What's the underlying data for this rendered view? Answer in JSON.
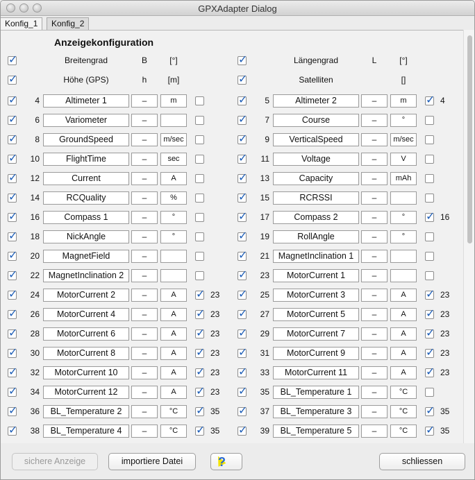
{
  "window": {
    "title": "GPXAdapter Dialog"
  },
  "tabs": [
    {
      "label": "Konfig_1"
    },
    {
      "label": "Konfig_2"
    }
  ],
  "panel": {
    "heading": "Anzeigekonfiguration",
    "fixed_rows": [
      {
        "left": {
          "checked": true,
          "name": "Breitengrad",
          "symbol": "B",
          "unit": "[°]"
        },
        "right": {
          "checked": true,
          "name": "Längengrad",
          "symbol": "L",
          "unit": "[°]"
        }
      },
      {
        "left": {
          "checked": true,
          "name": "Höhe (GPS)",
          "symbol": "h",
          "unit": "[m]"
        },
        "right": {
          "checked": true,
          "name": "Satelliten",
          "symbol": "",
          "unit": "[]"
        }
      }
    ],
    "rows": [
      {
        "left": {
          "checked": true,
          "num": "4",
          "name": "Altimeter 1",
          "symbol": "–",
          "unit": "m",
          "extra_checked": false,
          "extra_value": ""
        },
        "right": {
          "checked": true,
          "num": "5",
          "name": "Altimeter 2",
          "symbol": "–",
          "unit": "m",
          "extra_checked": true,
          "extra_value": "4"
        }
      },
      {
        "left": {
          "checked": true,
          "num": "6",
          "name": "Variometer",
          "symbol": "–",
          "unit": "",
          "extra_checked": false,
          "extra_value": ""
        },
        "right": {
          "checked": true,
          "num": "7",
          "name": "Course",
          "symbol": "–",
          "unit": "°",
          "extra_checked": false,
          "extra_value": ""
        }
      },
      {
        "left": {
          "checked": true,
          "num": "8",
          "name": "GroundSpeed",
          "symbol": "–",
          "unit": "m/sec",
          "extra_checked": false,
          "extra_value": ""
        },
        "right": {
          "checked": true,
          "num": "9",
          "name": "VerticalSpeed",
          "symbol": "–",
          "unit": "m/sec",
          "extra_checked": false,
          "extra_value": ""
        }
      },
      {
        "left": {
          "checked": true,
          "num": "10",
          "name": "FlightTime",
          "symbol": "–",
          "unit": "sec",
          "extra_checked": false,
          "extra_value": ""
        },
        "right": {
          "checked": true,
          "num": "11",
          "name": "Voltage",
          "symbol": "–",
          "unit": "V",
          "extra_checked": false,
          "extra_value": ""
        }
      },
      {
        "left": {
          "checked": true,
          "num": "12",
          "name": "Current",
          "symbol": "–",
          "unit": "A",
          "extra_checked": false,
          "extra_value": ""
        },
        "right": {
          "checked": true,
          "num": "13",
          "name": "Capacity",
          "symbol": "–",
          "unit": "mAh",
          "extra_checked": false,
          "extra_value": ""
        }
      },
      {
        "left": {
          "checked": true,
          "num": "14",
          "name": "RCQuality",
          "symbol": "–",
          "unit": "%",
          "extra_checked": false,
          "extra_value": ""
        },
        "right": {
          "checked": true,
          "num": "15",
          "name": "RCRSSI",
          "symbol": "–",
          "unit": "",
          "extra_checked": false,
          "extra_value": ""
        }
      },
      {
        "left": {
          "checked": true,
          "num": "16",
          "name": "Compass 1",
          "symbol": "–",
          "unit": "°",
          "extra_checked": false,
          "extra_value": ""
        },
        "right": {
          "checked": true,
          "num": "17",
          "name": "Compass 2",
          "symbol": "–",
          "unit": "°",
          "extra_checked": true,
          "extra_value": "16"
        }
      },
      {
        "left": {
          "checked": true,
          "num": "18",
          "name": "NickAngle",
          "symbol": "–",
          "unit": "°",
          "extra_checked": false,
          "extra_value": ""
        },
        "right": {
          "checked": true,
          "num": "19",
          "name": "RollAngle",
          "symbol": "–",
          "unit": "°",
          "extra_checked": false,
          "extra_value": ""
        }
      },
      {
        "left": {
          "checked": true,
          "num": "20",
          "name": "MagnetField",
          "symbol": "–",
          "unit": "",
          "extra_checked": false,
          "extra_value": ""
        },
        "right": {
          "checked": true,
          "num": "21",
          "name": "MagnetInclination 1",
          "symbol": "–",
          "unit": "",
          "extra_checked": false,
          "extra_value": ""
        }
      },
      {
        "left": {
          "checked": true,
          "num": "22",
          "name": "MagnetInclination 2",
          "symbol": "–",
          "unit": "",
          "extra_checked": false,
          "extra_value": ""
        },
        "right": {
          "checked": true,
          "num": "23",
          "name": "MotorCurrent 1",
          "symbol": "–",
          "unit": "",
          "extra_checked": false,
          "extra_value": ""
        }
      },
      {
        "left": {
          "checked": true,
          "num": "24",
          "name": "MotorCurrent 2",
          "symbol": "–",
          "unit": "A",
          "extra_checked": true,
          "extra_value": "23"
        },
        "right": {
          "checked": true,
          "num": "25",
          "name": "MotorCurrent 3",
          "symbol": "–",
          "unit": "A",
          "extra_checked": true,
          "extra_value": "23"
        }
      },
      {
        "left": {
          "checked": true,
          "num": "26",
          "name": "MotorCurrent 4",
          "symbol": "–",
          "unit": "A",
          "extra_checked": true,
          "extra_value": "23"
        },
        "right": {
          "checked": true,
          "num": "27",
          "name": "MotorCurrent 5",
          "symbol": "–",
          "unit": "A",
          "extra_checked": true,
          "extra_value": "23"
        }
      },
      {
        "left": {
          "checked": true,
          "num": "28",
          "name": "MotorCurrent 6",
          "symbol": "–",
          "unit": "A",
          "extra_checked": true,
          "extra_value": "23"
        },
        "right": {
          "checked": true,
          "num": "29",
          "name": "MotorCurrent 7",
          "symbol": "–",
          "unit": "A",
          "extra_checked": true,
          "extra_value": "23"
        }
      },
      {
        "left": {
          "checked": true,
          "num": "30",
          "name": "MotorCurrent 8",
          "symbol": "–",
          "unit": "A",
          "extra_checked": true,
          "extra_value": "23"
        },
        "right": {
          "checked": true,
          "num": "31",
          "name": "MotorCurrent 9",
          "symbol": "–",
          "unit": "A",
          "extra_checked": true,
          "extra_value": "23"
        }
      },
      {
        "left": {
          "checked": true,
          "num": "32",
          "name": "MotorCurrent 10",
          "symbol": "–",
          "unit": "A",
          "extra_checked": true,
          "extra_value": "23"
        },
        "right": {
          "checked": true,
          "num": "33",
          "name": "MotorCurrent 11",
          "symbol": "–",
          "unit": "A",
          "extra_checked": true,
          "extra_value": "23"
        }
      },
      {
        "left": {
          "checked": true,
          "num": "34",
          "name": "MotorCurrent 12",
          "symbol": "–",
          "unit": "A",
          "extra_checked": true,
          "extra_value": "23"
        },
        "right": {
          "checked": true,
          "num": "35",
          "name": "BL_Temperature 1",
          "symbol": "–",
          "unit": "°C",
          "extra_checked": false,
          "extra_value": ""
        }
      },
      {
        "left": {
          "checked": true,
          "num": "36",
          "name": "BL_Temperature 2",
          "symbol": "–",
          "unit": "°C",
          "extra_checked": true,
          "extra_value": "35"
        },
        "right": {
          "checked": true,
          "num": "37",
          "name": "BL_Temperature 3",
          "symbol": "–",
          "unit": "°C",
          "extra_checked": true,
          "extra_value": "35"
        }
      },
      {
        "left": {
          "checked": true,
          "num": "38",
          "name": "BL_Temperature 4",
          "symbol": "–",
          "unit": "°C",
          "extra_checked": true,
          "extra_value": "35"
        },
        "right": {
          "checked": true,
          "num": "39",
          "name": "BL_Temperature 5",
          "symbol": "–",
          "unit": "°C",
          "extra_checked": true,
          "extra_value": "35"
        }
      }
    ]
  },
  "footer": {
    "safe_display_label": "sichere Anzeige",
    "import_label": "importiere Datei",
    "help_icon": "help-cursor-icon",
    "close_label": "schliessen"
  },
  "colors": {
    "check_accent": "#1f5fb8"
  }
}
